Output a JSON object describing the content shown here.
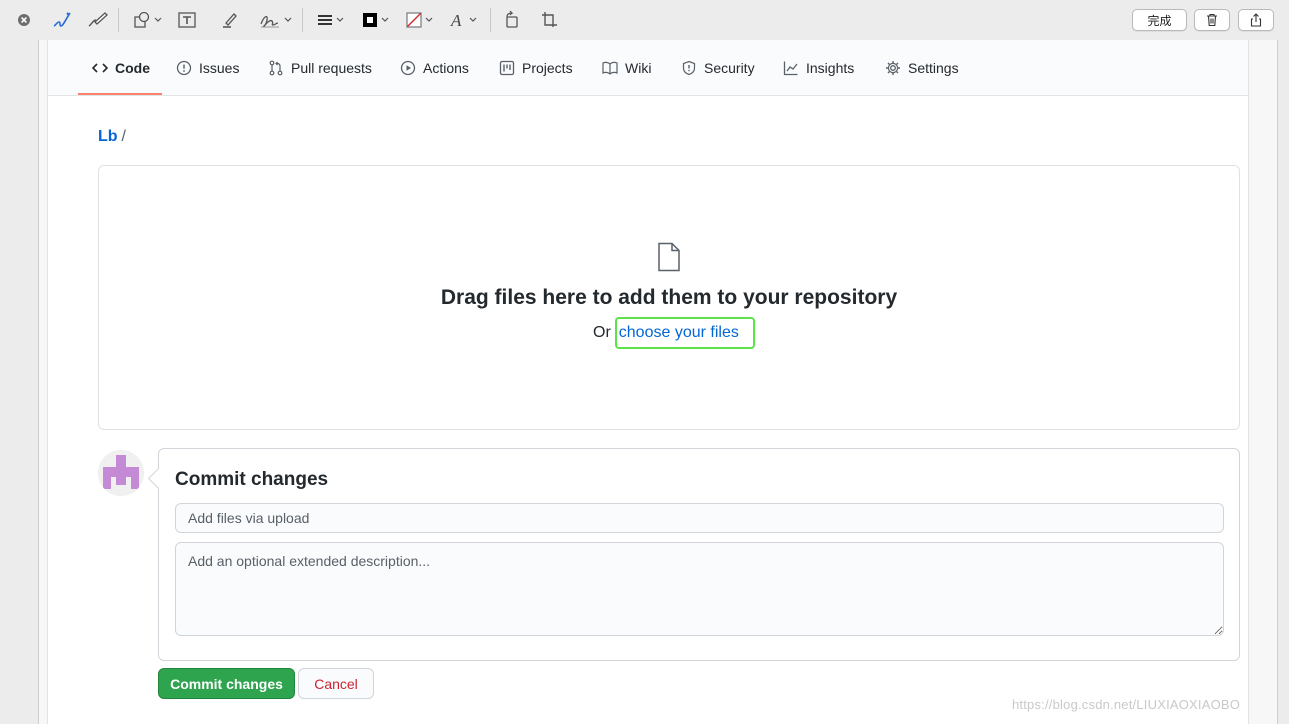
{
  "toolbar": {
    "done_label": "完成",
    "colors": {
      "stroke": "#000000",
      "fill_swatch_border": "#c8102e",
      "pen_icon": "#2a6cd6"
    }
  },
  "nav": {
    "tabs": [
      {
        "label": "Code",
        "icon": "code-icon"
      },
      {
        "label": "Issues",
        "icon": "issue-icon"
      },
      {
        "label": "Pull requests",
        "icon": "pull-request-icon"
      },
      {
        "label": "Actions",
        "icon": "play-icon"
      },
      {
        "label": "Projects",
        "icon": "project-icon"
      },
      {
        "label": "Wiki",
        "icon": "book-icon"
      },
      {
        "label": "Security",
        "icon": "shield-icon"
      },
      {
        "label": "Insights",
        "icon": "graph-icon"
      },
      {
        "label": "Settings",
        "icon": "gear-icon"
      }
    ],
    "selected": "Code",
    "accent": "#f9826c"
  },
  "breadcrumb": {
    "repo": "Lb",
    "separator": "/"
  },
  "upload": {
    "title": "Drag files here to add them to your repository",
    "prefix": "Or",
    "link_label": "choose your files",
    "highlight_color": "#5ce34a"
  },
  "commit": {
    "title": "Commit changes",
    "summary_placeholder": "Add files via upload",
    "description_placeholder": "Add an optional extended description...",
    "commit_button_label": "Commit changes",
    "cancel_button_label": "Cancel",
    "commit_button_color": "#2ea44f",
    "cancel_text_color": "#cb2431"
  },
  "watermark": "https://blog.csdn.net/LIUXIAOXIAOBO"
}
